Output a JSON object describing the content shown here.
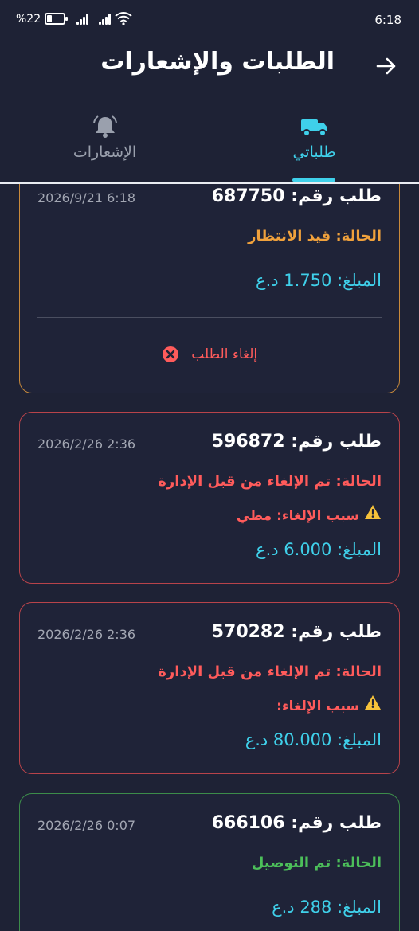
{
  "status_bar": {
    "battery_text": "%22",
    "time": "6:18"
  },
  "header": {
    "title": "الطلبات والإشعارات",
    "back_icon": "arrow-right-icon"
  },
  "tabs": [
    {
      "label": "طلباتي",
      "icon": "truck-icon",
      "active": true
    },
    {
      "label": "الإشعارات",
      "icon": "bell-icon",
      "active": false
    }
  ],
  "colors": {
    "background": "#1e2235",
    "accent": "#3fd0ea",
    "pending": "#f0a13c",
    "cancelled": "#ff5b5b",
    "delivered": "#4cbf5a"
  },
  "orders": [
    {
      "title": "طلب رقم: 687750",
      "date": "2026/9/21 6:18",
      "status": "الحالة: قيد الانتظار",
      "amount": "المبلغ: 1.750 د.ع",
      "cancel_label": "إلغاء الطلب"
    },
    {
      "title": "طلب رقم: 596872",
      "date": "2026/2/26 2:36",
      "status": "الحالة: تم الإلغاء من قبل الإدارة",
      "reason": "سبب الإلغاء: مطي",
      "amount": "المبلغ: 6.000 د.ع"
    },
    {
      "title": "طلب رقم: 570282",
      "date": "2026/2/26 2:36",
      "status": "الحالة: تم الإلغاء من قبل الإدارة",
      "reason": "سبب الإلغاء:",
      "amount": "المبلغ: 80.000 د.ع"
    },
    {
      "title": "طلب رقم: 666106",
      "date": "2026/2/26 0:07",
      "status": "الحالة: تم التوصيل",
      "amount": "المبلغ: 288 د.ع"
    }
  ]
}
